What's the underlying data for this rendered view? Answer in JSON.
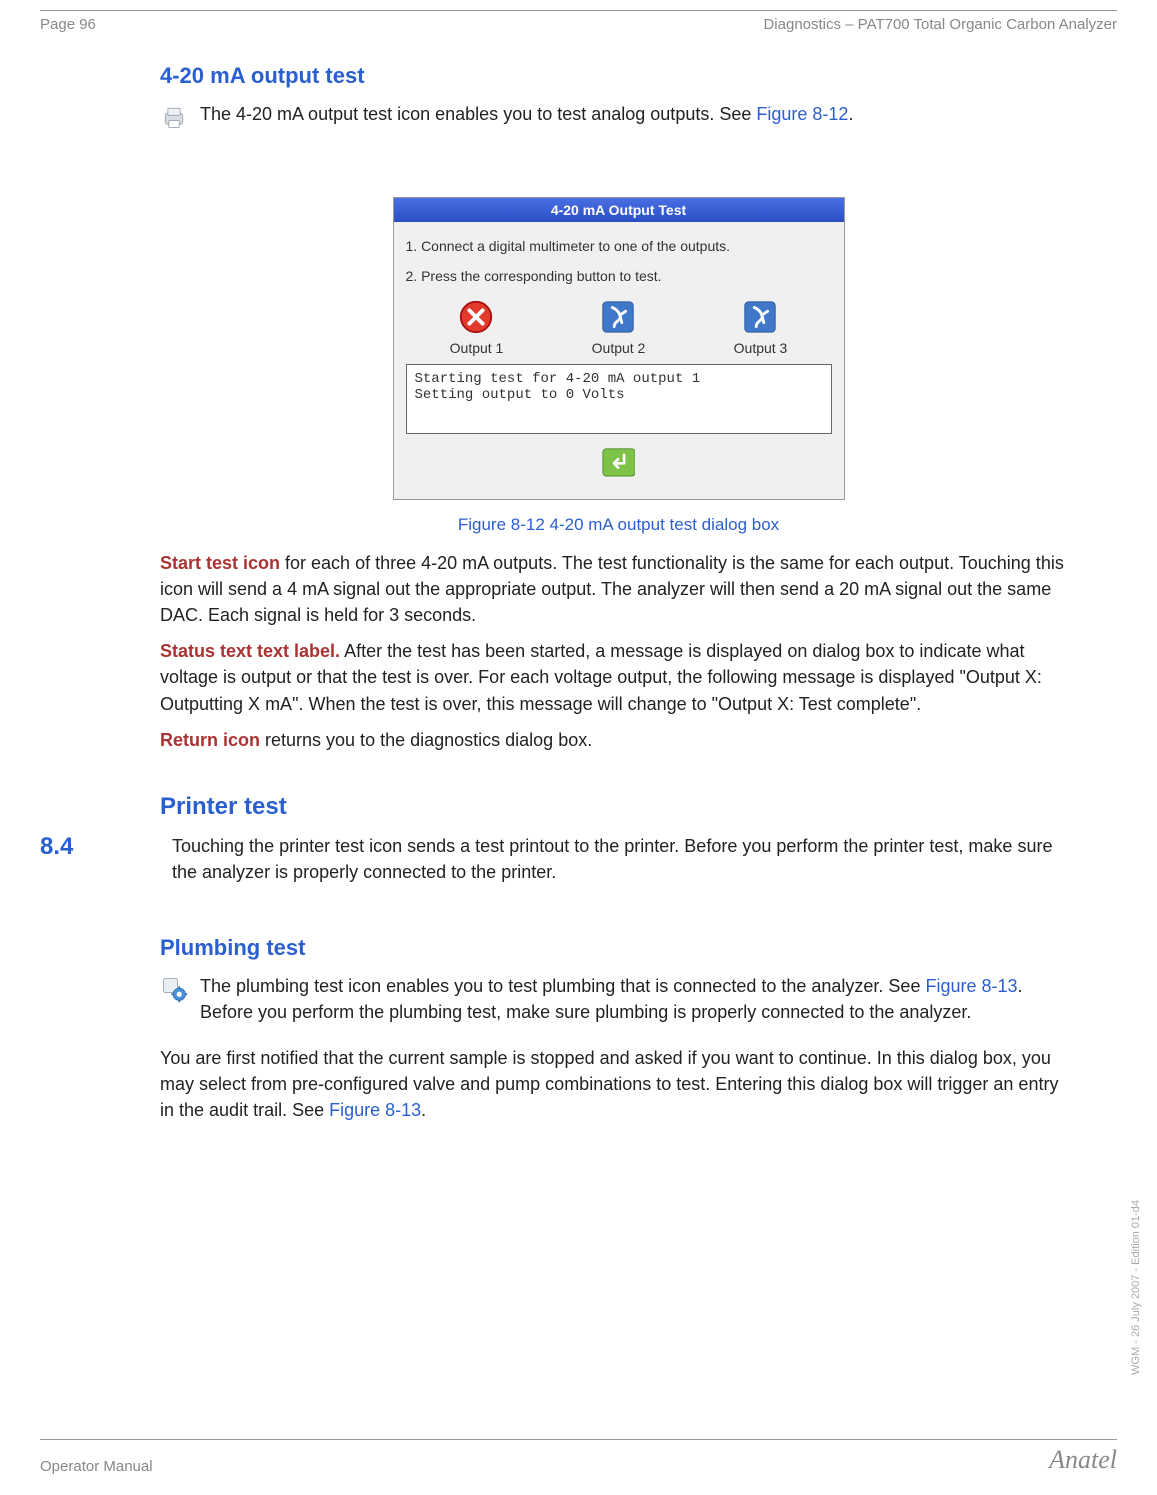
{
  "header": {
    "page_label": "Page 96",
    "doc_title": "Diagnostics – PAT700 Total Organic Carbon Analyzer"
  },
  "sections": {
    "output_test": {
      "heading": "4-20 mA output test",
      "intro": "The 4-20 mA output test icon enables you to test analog outputs. See ",
      "intro_link": "Figure 8-12",
      "intro_after": "."
    },
    "figure": {
      "title": "4-20 mA Output Test",
      "step1": "1. Connect a digital multimeter to one of the outputs.",
      "step2": "2. Press the corresponding button to test.",
      "out1": "Output 1",
      "out2": "Output 2",
      "out3": "Output 3",
      "status": "Starting test for 4-20 mA output 1\nSetting output to 0 Volts",
      "caption": "Figure 8-12 4-20 mA output test dialog box"
    },
    "desc": {
      "start_lead": "Start test icon",
      "start_body": " for each of three 4-20 mA outputs. The test functionality is the same for each output. Touching this icon will send a 4 mA signal out the appropriate output. The analyzer will then send a 20 mA signal out the same DAC. Each signal is held for 3 seconds.",
      "status_lead": "Status text text label.",
      "status_body": " After the test has been started, a message is displayed on dialog box to indicate what voltage is output or that the test is over. For each voltage output, the following message is displayed \"Output X: Outputting X mA\". When the test is over, this message will change to \"Output X: Test complete\".",
      "return_lead": "Return icon",
      "return_body": " returns you to the diagnostics dialog box."
    },
    "printer": {
      "num": "8.4",
      "heading": "Printer test",
      "body": "Touching the printer test icon sends a test printout to the printer. Before you perform the printer test, make sure the analyzer is properly connected to the printer."
    },
    "plumbing": {
      "heading": "Plumbing test",
      "intro_before": "The plumbing test icon enables you to test plumbing that is connected to the analyzer. See ",
      "intro_link": "Figure 8-13",
      "intro_after": ". Before you perform the plumbing test, make sure plumbing is properly connected to the analyzer.",
      "para2_before": "You are first notified that the current sample is stopped and asked if you want to continue. In this dialog box, you may select from pre-configured valve and pump combinations to test. Entering this dialog box will trigger an entry in the audit trail. See ",
      "para2_link": "Figure 8-13",
      "para2_after": "."
    }
  },
  "side_text": "WGM - 26 July 2007 - Edition 01-d4",
  "footer": {
    "left": "Operator Manual",
    "right": "Anatel"
  }
}
